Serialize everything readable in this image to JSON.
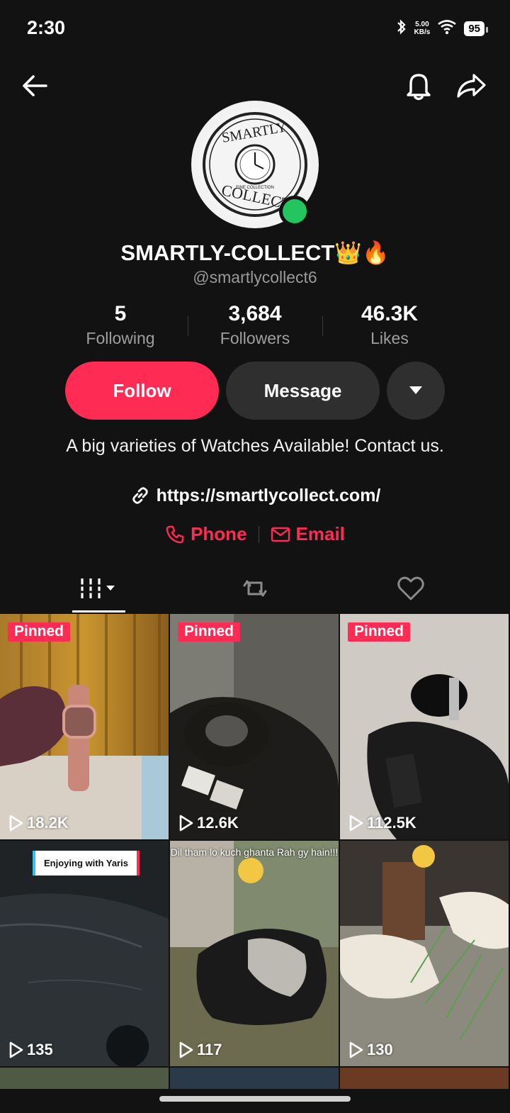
{
  "status_bar": {
    "time": "2:30",
    "speed_value": "5.00",
    "speed_unit": "KB/s",
    "battery": "95"
  },
  "profile": {
    "display_name": "SMARTLY-COLLECT👑🔥",
    "handle": "@smartlycollect6",
    "avatar_brand_top": "SMARTLY",
    "avatar_brand_bottom": "COLLECT",
    "avatar_tagline": "FINE COLLECTION"
  },
  "stats": [
    {
      "value": "5",
      "label": "Following"
    },
    {
      "value": "3,684",
      "label": "Followers"
    },
    {
      "value": "46.3K",
      "label": "Likes"
    }
  ],
  "actions": {
    "follow_label": "Follow",
    "message_label": "Message"
  },
  "bio": {
    "text": "A big varieties of Watches Available! Contact us.",
    "link": "https://smartlycollect.com/",
    "phone_label": "Phone",
    "email_label": "Email"
  },
  "tabs": [
    "videos-grid",
    "reposts",
    "liked"
  ],
  "videos": [
    {
      "pinned_label": "Pinned",
      "views": "18.2K"
    },
    {
      "pinned_label": "Pinned",
      "views": "12.6K"
    },
    {
      "pinned_label": "Pinned",
      "views": "112.5K"
    },
    {
      "overlay": "Enjoying with Yaris",
      "views": "135"
    },
    {
      "caption": "Dil tham lo kuch ghanta Rah gy hain!!!",
      "views": "117"
    },
    {
      "views": "130"
    }
  ],
  "colors": {
    "accent": "#fe2c55",
    "background": "#121212",
    "online": "#22c55e"
  }
}
